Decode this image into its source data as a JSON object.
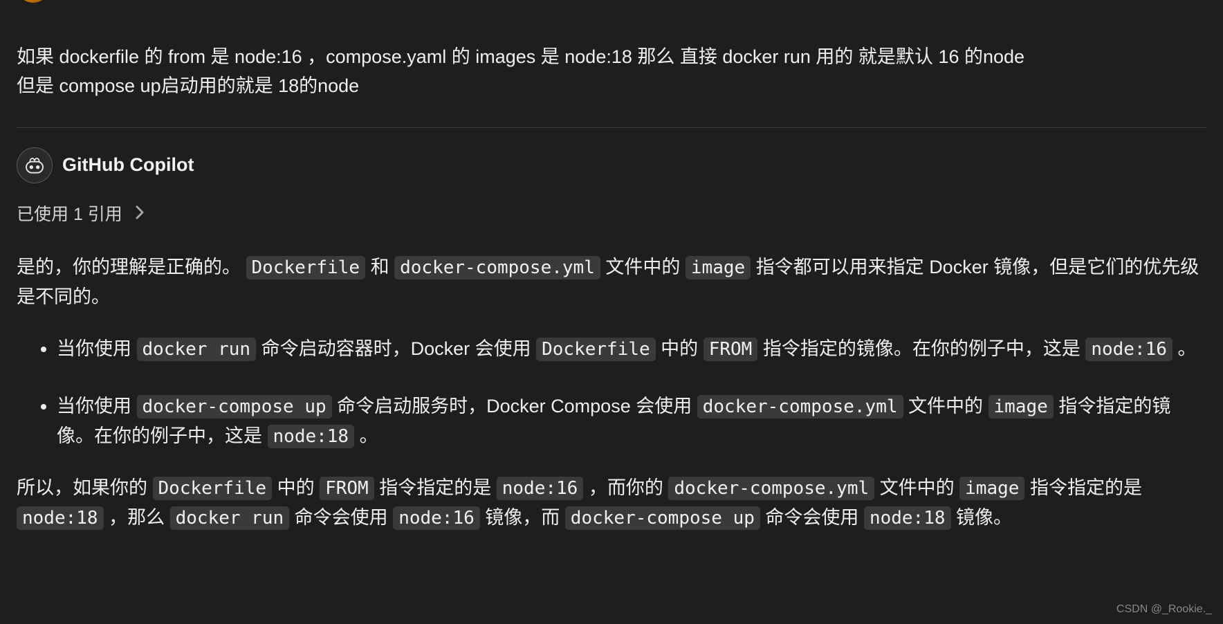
{
  "user": {
    "message_line1": "如果 dockerfile 的 from 是 node:16 ，compose.yaml 的 images 是 node:18 那么 直接 docker run 用的 就是默认 16 的node",
    "message_line2": "但是 compose up启动用的就是 18的node"
  },
  "copilot": {
    "name": "GitHub Copilot",
    "reference": "已使用 1 引用",
    "intro_prefix": "是的，你的理解是正确的。",
    "code_dockerfile": "Dockerfile",
    "intro_and": " 和 ",
    "code_compose_yml": "docker-compose.yml",
    "intro_mid1": " 文件中的 ",
    "code_image": "image",
    "intro_suffix": " 指令都可以用来指定 Docker 镜像，但是它们的优先级是不同的。",
    "bullet1": {
      "t1": "当你使用 ",
      "c1": "docker run",
      "t2": " 命令启动容器时，Docker 会使用 ",
      "c2": "Dockerfile",
      "t3": " 中的 ",
      "c3": "FROM",
      "t4": " 指令指定的镜像。在你的例子中，这是 ",
      "c4": "node:16",
      "t5": " 。"
    },
    "bullet2": {
      "t1": "当你使用 ",
      "c1": "docker-compose up",
      "t2": " 命令启动服务时，Docker Compose 会使用 ",
      "c2": "docker-compose.yml",
      "t3": " 文件中的 ",
      "c3": "image",
      "t4": " 指令指定的镜像。在你的例子中，这是 ",
      "c4": "node:18",
      "t5": " 。"
    },
    "conclusion": {
      "t1": "所以，如果你的 ",
      "c1": "Dockerfile",
      "t2": " 中的 ",
      "c2": "FROM",
      "t3": " 指令指定的是 ",
      "c3": "node:16",
      "t4": "，而你的 ",
      "c4": "docker-compose.yml",
      "t5": " 文件中的 ",
      "c5": "image",
      "t6": " 指令指定的是 ",
      "c6": "node:18",
      "t7": "，那么 ",
      "c7": "docker run",
      "t8": " 命令会使用 ",
      "c8": "node:16",
      "t9": " 镜像，而 ",
      "c9": "docker-compose up",
      "t10": " 命令会使用 ",
      "c10": "node:18",
      "t11": " 镜像。"
    }
  },
  "watermark": "CSDN @_Rookie._"
}
